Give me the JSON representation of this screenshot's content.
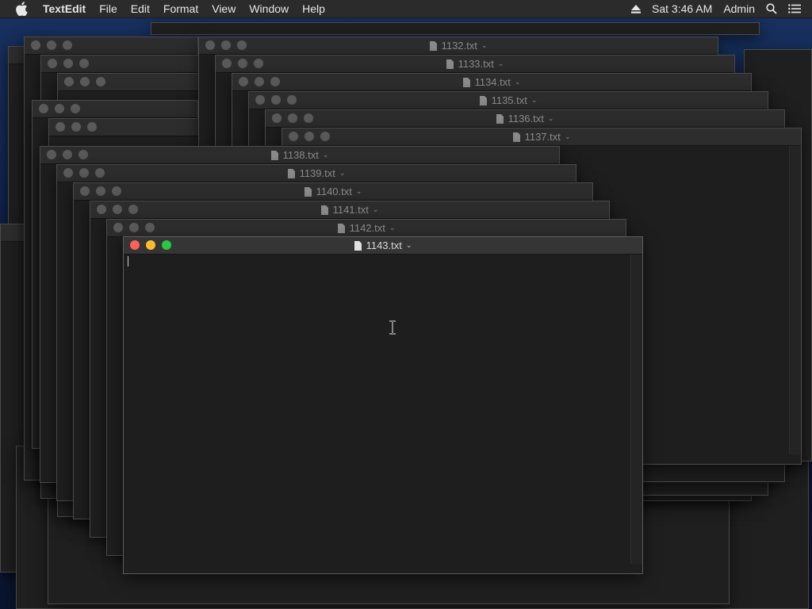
{
  "menubar": {
    "app_name": "TextEdit",
    "items": [
      "File",
      "Edit",
      "Format",
      "View",
      "Window",
      "Help"
    ],
    "clock": "Sat 3:46 AM",
    "user": "Admin"
  },
  "windows": {
    "w1132": "1132.txt",
    "w1133": "1133.txt",
    "w1134": "1134.txt",
    "w1135": "1135.txt",
    "w1136": "1136.txt",
    "w1137": "1137.txt",
    "w1138": "1138.txt",
    "w1139": "1139.txt",
    "w1140": "1140.txt",
    "w1141": "1141.txt",
    "w1142": "1142.txt",
    "w1143": "1143.txt"
  },
  "active_window": "1143.txt",
  "colors": {
    "close": "#fe5f57",
    "minimize": "#febc2e",
    "zoom": "#28c840"
  }
}
